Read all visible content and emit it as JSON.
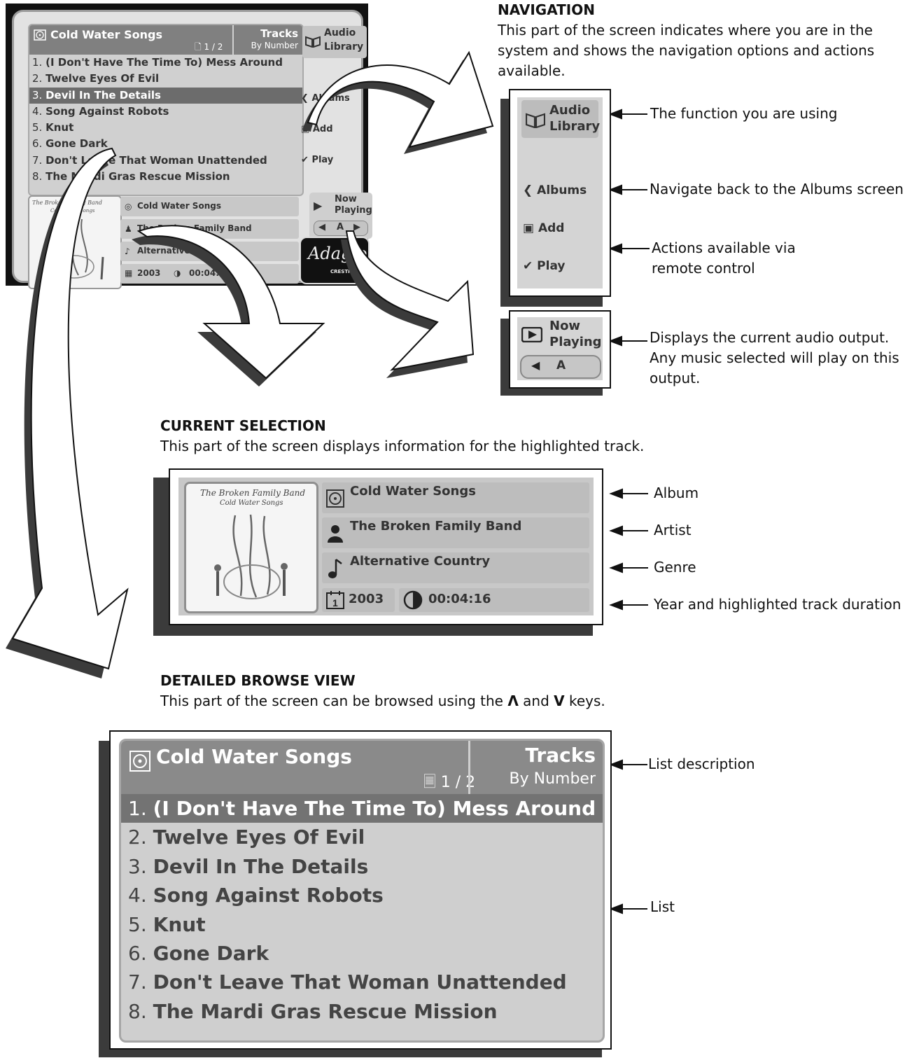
{
  "app": {
    "album_title": "Cold Water Songs",
    "page": "1 / 2",
    "sort_title": "Tracks",
    "sort_mode": "By Number",
    "function_label_1": "Audio",
    "function_label_2": "Library",
    "nav_back": "Albums",
    "nav_add": "Add",
    "nav_play": "Play",
    "now_playing_1": "Now",
    "now_playing_2": "Playing",
    "output": "A",
    "logo": "Adagio",
    "logo_sub": "CRESTRON",
    "art_band": "The Broken Family Band",
    "art_album": "Cold Water Songs",
    "selected_index_small": 2,
    "selected_index_browse": 0,
    "tracks": [
      {
        "num": "1.",
        "title": "(I Don't Have The Time To) Mess Around"
      },
      {
        "num": "2.",
        "title": "Twelve Eyes Of Evil"
      },
      {
        "num": "3.",
        "title": "Devil In The Details"
      },
      {
        "num": "4.",
        "title": "Song Against Robots"
      },
      {
        "num": "5.",
        "title": "Knut"
      },
      {
        "num": "6.",
        "title": "Gone Dark"
      },
      {
        "num": "7.",
        "title": "Don't Leave That Woman Unattended"
      },
      {
        "num": "8.",
        "title": "The Mardi Gras Rescue Mission"
      }
    ],
    "selection": {
      "album": "Cold Water Songs",
      "artist": "The Broken Family Band",
      "genre": "Alternative Country",
      "year": "2003",
      "duration": "00:04:16"
    }
  },
  "sections": {
    "navigation": {
      "title": "NAVIGATION",
      "desc_1": "This part of the screen indicates where you are in the",
      "desc_2": "system and shows the navigation options and actions",
      "desc_3": "available."
    },
    "current_selection": {
      "title": "CURRENT SELECTION",
      "desc": "This part of the screen displays information for the highlighted track."
    },
    "browse": {
      "title": "DETAILED BROWSE VIEW",
      "desc_before": "This part of the screen can be browsed using the",
      "desc_and": "and",
      "desc_after": "keys."
    }
  },
  "callouts": {
    "function": "The function you are using",
    "back": "Navigate back to the Albums screen",
    "actions_1": "Actions available via",
    "actions_2": "remote control",
    "output_1": "Displays the current audio output.",
    "output_2": "Any music selected will play on this",
    "output_3": "output.",
    "album": "Album",
    "artist": "Artist",
    "genre": "Genre",
    "year_duration": "Year and highlighted track duration",
    "list_desc": "List description",
    "list": "List"
  },
  "colors": {
    "shadow": "#3b3b3b",
    "header": "#808080",
    "highlight": "#6c6c6c",
    "panel": "#d0d0d0"
  }
}
